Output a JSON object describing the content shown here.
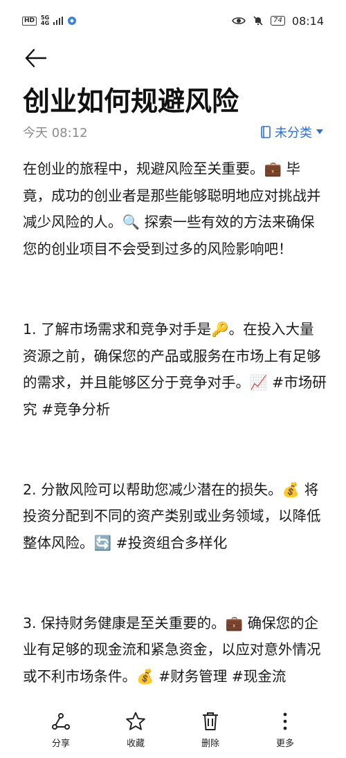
{
  "status_bar": {
    "hd": "HD",
    "net_top": "5G",
    "net_bottom": "4G",
    "battery": "74",
    "time": "08:14"
  },
  "note": {
    "title": "创业如何规避风险",
    "timestamp": "今天 08:12",
    "category": "未分类",
    "paragraphs": [
      "在创业的旅程中，规避风险至关重要。💼 毕竟，成功的创业者是那些能够聪明地应对挑战并减少风险的人。🔍 探索一些有效的方法来确保您的创业项目不会受到过多的风险影响吧！",
      "1. 了解市场需求和竞争对手是🔑。在投入大量资源之前，确保您的产品或服务在市场上有足够的需求，并且能够区分于竞争对手。📈 #市场研究 #竞争分析",
      "2. 分散风险可以帮助您减少潜在的损失。💰 将投资分配到不同的资产类别或业务领域，以降低整体风险。🔄 #投资组合多样化",
      "3. 保持财务健康是至关重要的。💼 确保您的企业有足够的现金流和紧急资金，以应对意外情况或不利市场条件。💰 #财务管理 #现金流"
    ]
  },
  "bottom_bar": {
    "share": "分享",
    "favorite": "收藏",
    "delete": "删除",
    "more": "更多"
  },
  "colors": {
    "accent": "#2f6fd6",
    "muted": "#8a8a8a"
  }
}
